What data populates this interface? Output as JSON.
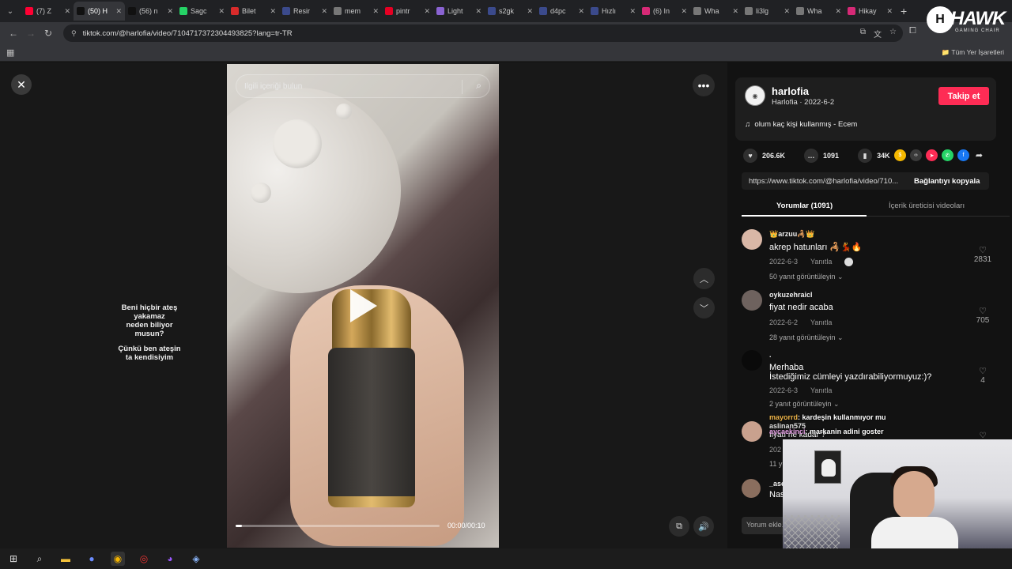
{
  "browser": {
    "tabs": [
      {
        "label": "(7) Z",
        "color": "#ff0033"
      },
      {
        "label": "(50) H",
        "color": "#111111",
        "active": true
      },
      {
        "label": "(56) n",
        "color": "#111111"
      },
      {
        "label": "Sagc",
        "color": "#25d366"
      },
      {
        "label": "Bilet",
        "color": "#d92b2b"
      },
      {
        "label": "Resir",
        "color": "#3b4a8c"
      },
      {
        "label": "mem",
        "color": "#777777"
      },
      {
        "label": "pintr",
        "color": "#e60023"
      },
      {
        "label": "Light",
        "color": "#8a63d2"
      },
      {
        "label": "s2gk",
        "color": "#3b4a8c"
      },
      {
        "label": "d4pc",
        "color": "#3b4a8c"
      },
      {
        "label": "Hızlı",
        "color": "#3b4a8c"
      },
      {
        "label": "(6) In",
        "color": "#d62976"
      },
      {
        "label": "Wha",
        "color": "#777777"
      },
      {
        "label": "li3lg",
        "color": "#777777"
      },
      {
        "label": "Wha",
        "color": "#777777"
      },
      {
        "label": "Hikay",
        "color": "#d62976"
      }
    ],
    "url": "tiktok.com/@harlofia/video/7104717372304493825?lang=tr-TR",
    "bookmarks_all": "Tüm Yer İşaretleri"
  },
  "overlay_logo": {
    "word": "HAWK",
    "sub": "GAMING CHAIR"
  },
  "video": {
    "search_placeholder": "İlgili içeriği bulun",
    "engraving_lines": [
      "Beni hiçbir ateş",
      "yakamaz",
      "neden biliyor",
      "musun?",
      "Çünkü ben ateşin",
      "ta kendisiyim"
    ],
    "time": "00:00/00:10",
    "progress_fraction": 0.03
  },
  "author": {
    "username": "harlofia",
    "subline": "Harlofia · 2022-6-2",
    "follow_label": "Takip et",
    "music": "olum kaç kişi kullanmış - Ecem"
  },
  "stats": {
    "likes": "206.6K",
    "comments": "1091",
    "saves": "34K"
  },
  "share_colors": [
    "#f5b800",
    "#3a3a3a",
    "#fe2c55",
    "#25d366",
    "#1877f2"
  ],
  "link": {
    "url": "https://www.tiktok.com/@harlofia/video/710...",
    "copy_label": "Bağlantıyı kopyala"
  },
  "panel_tabs": {
    "comments": "Yorumlar (1091)",
    "creator_videos": "İçerik üreticisi videoları"
  },
  "comments": [
    {
      "user": "👑arzuu🦂👑",
      "text": "akrep hatunları 🦂💃🔥",
      "date": "2022-6-3",
      "reply_label": "Yanıtla",
      "replies": "50 yanıt görüntüleyin ⌄",
      "likes": "2831",
      "avatar_color": "#d9b7a6"
    },
    {
      "user": "oykuzehraicl",
      "text": "fiyat nedir acaba",
      "date": "2022-6-2",
      "reply_label": "Yanıtla",
      "replies": "28 yanıt görüntüleyin ⌄",
      "likes": "705",
      "avatar_color": "#8a7c78"
    },
    {
      "user": ".",
      "text": "Merhaba",
      "text2": "İstediğimiz cümleyi yazdırabiliyormuyuz:)?",
      "date": "2022-6-3",
      "reply_label": "Yanıtla",
      "replies": "2 yanıt görüntüleyin ⌄",
      "likes": "4",
      "avatar_color": "#111111"
    }
  ],
  "partial": {
    "user4": "aslinan575",
    "text4": "fiyatı ne kadar ?",
    "date4": "202",
    "replies4": "11 y",
    "user5": "_ase",
    "text5": "Nas",
    "likes4": "♡"
  },
  "stream_chat": [
    {
      "name": "mayorrd",
      "msg": ": kardeşin kullanmıyor mu"
    },
    {
      "name": "aycaekinci",
      "msg": ": markanin adini goster"
    }
  ],
  "comment_input_placeholder": "Yorum ekle..."
}
